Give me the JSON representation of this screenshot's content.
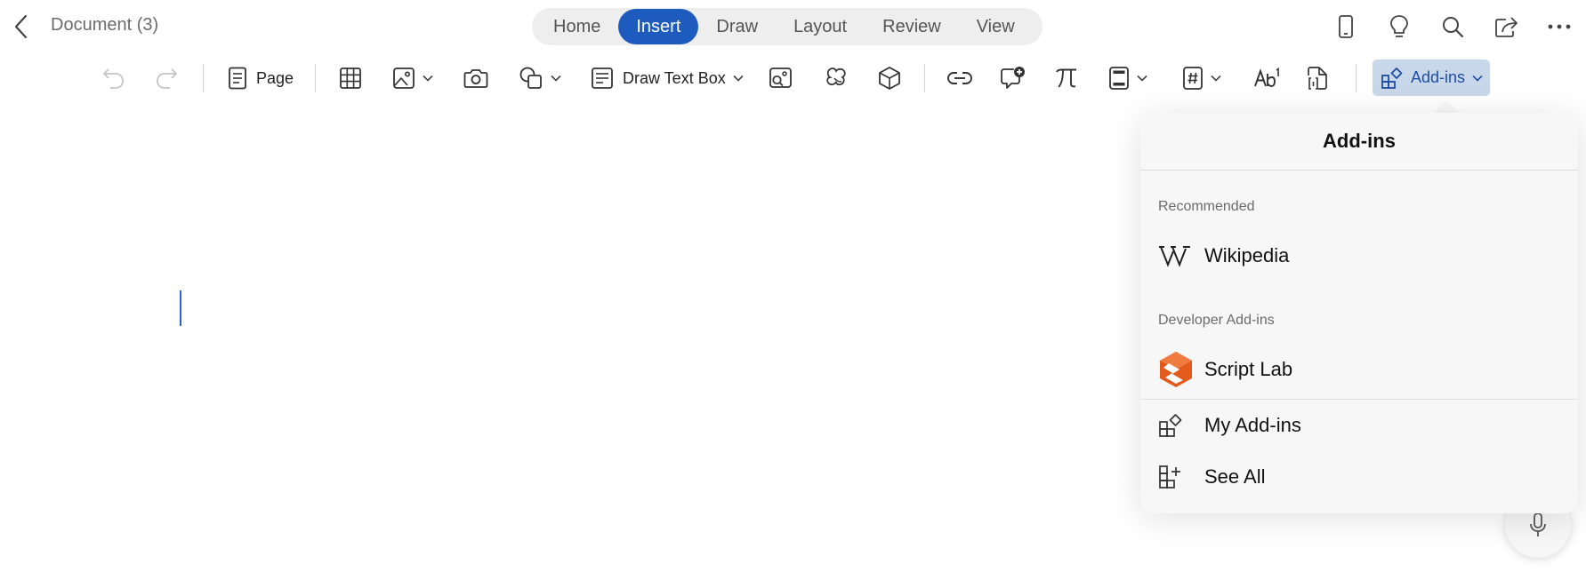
{
  "header": {
    "document_title": "Document (3)",
    "tabs": [
      {
        "label": "Home",
        "active": false
      },
      {
        "label": "Insert",
        "active": true
      },
      {
        "label": "Draw",
        "active": false
      },
      {
        "label": "Layout",
        "active": false
      },
      {
        "label": "Review",
        "active": false
      },
      {
        "label": "View",
        "active": false
      }
    ],
    "right_icons": [
      "phone-view-icon",
      "lightbulb-icon",
      "search-icon",
      "share-icon",
      "more-icon"
    ]
  },
  "ribbon": {
    "page_label": "Page",
    "draw_text_box_label": "Draw Text Box",
    "addins_label": "Add-ins"
  },
  "popover": {
    "title": "Add-ins",
    "recommended_header": "Recommended",
    "wikipedia_label": "Wikipedia",
    "developer_header": "Developer Add-ins",
    "script_lab_label": "Script Lab",
    "my_addins_label": "My Add-ins",
    "see_all_label": "See All"
  },
  "colors": {
    "accent": "#1e5bbf",
    "addins_button_bg": "#c9d7ea",
    "script_lab_orange": "#e25a1c"
  }
}
